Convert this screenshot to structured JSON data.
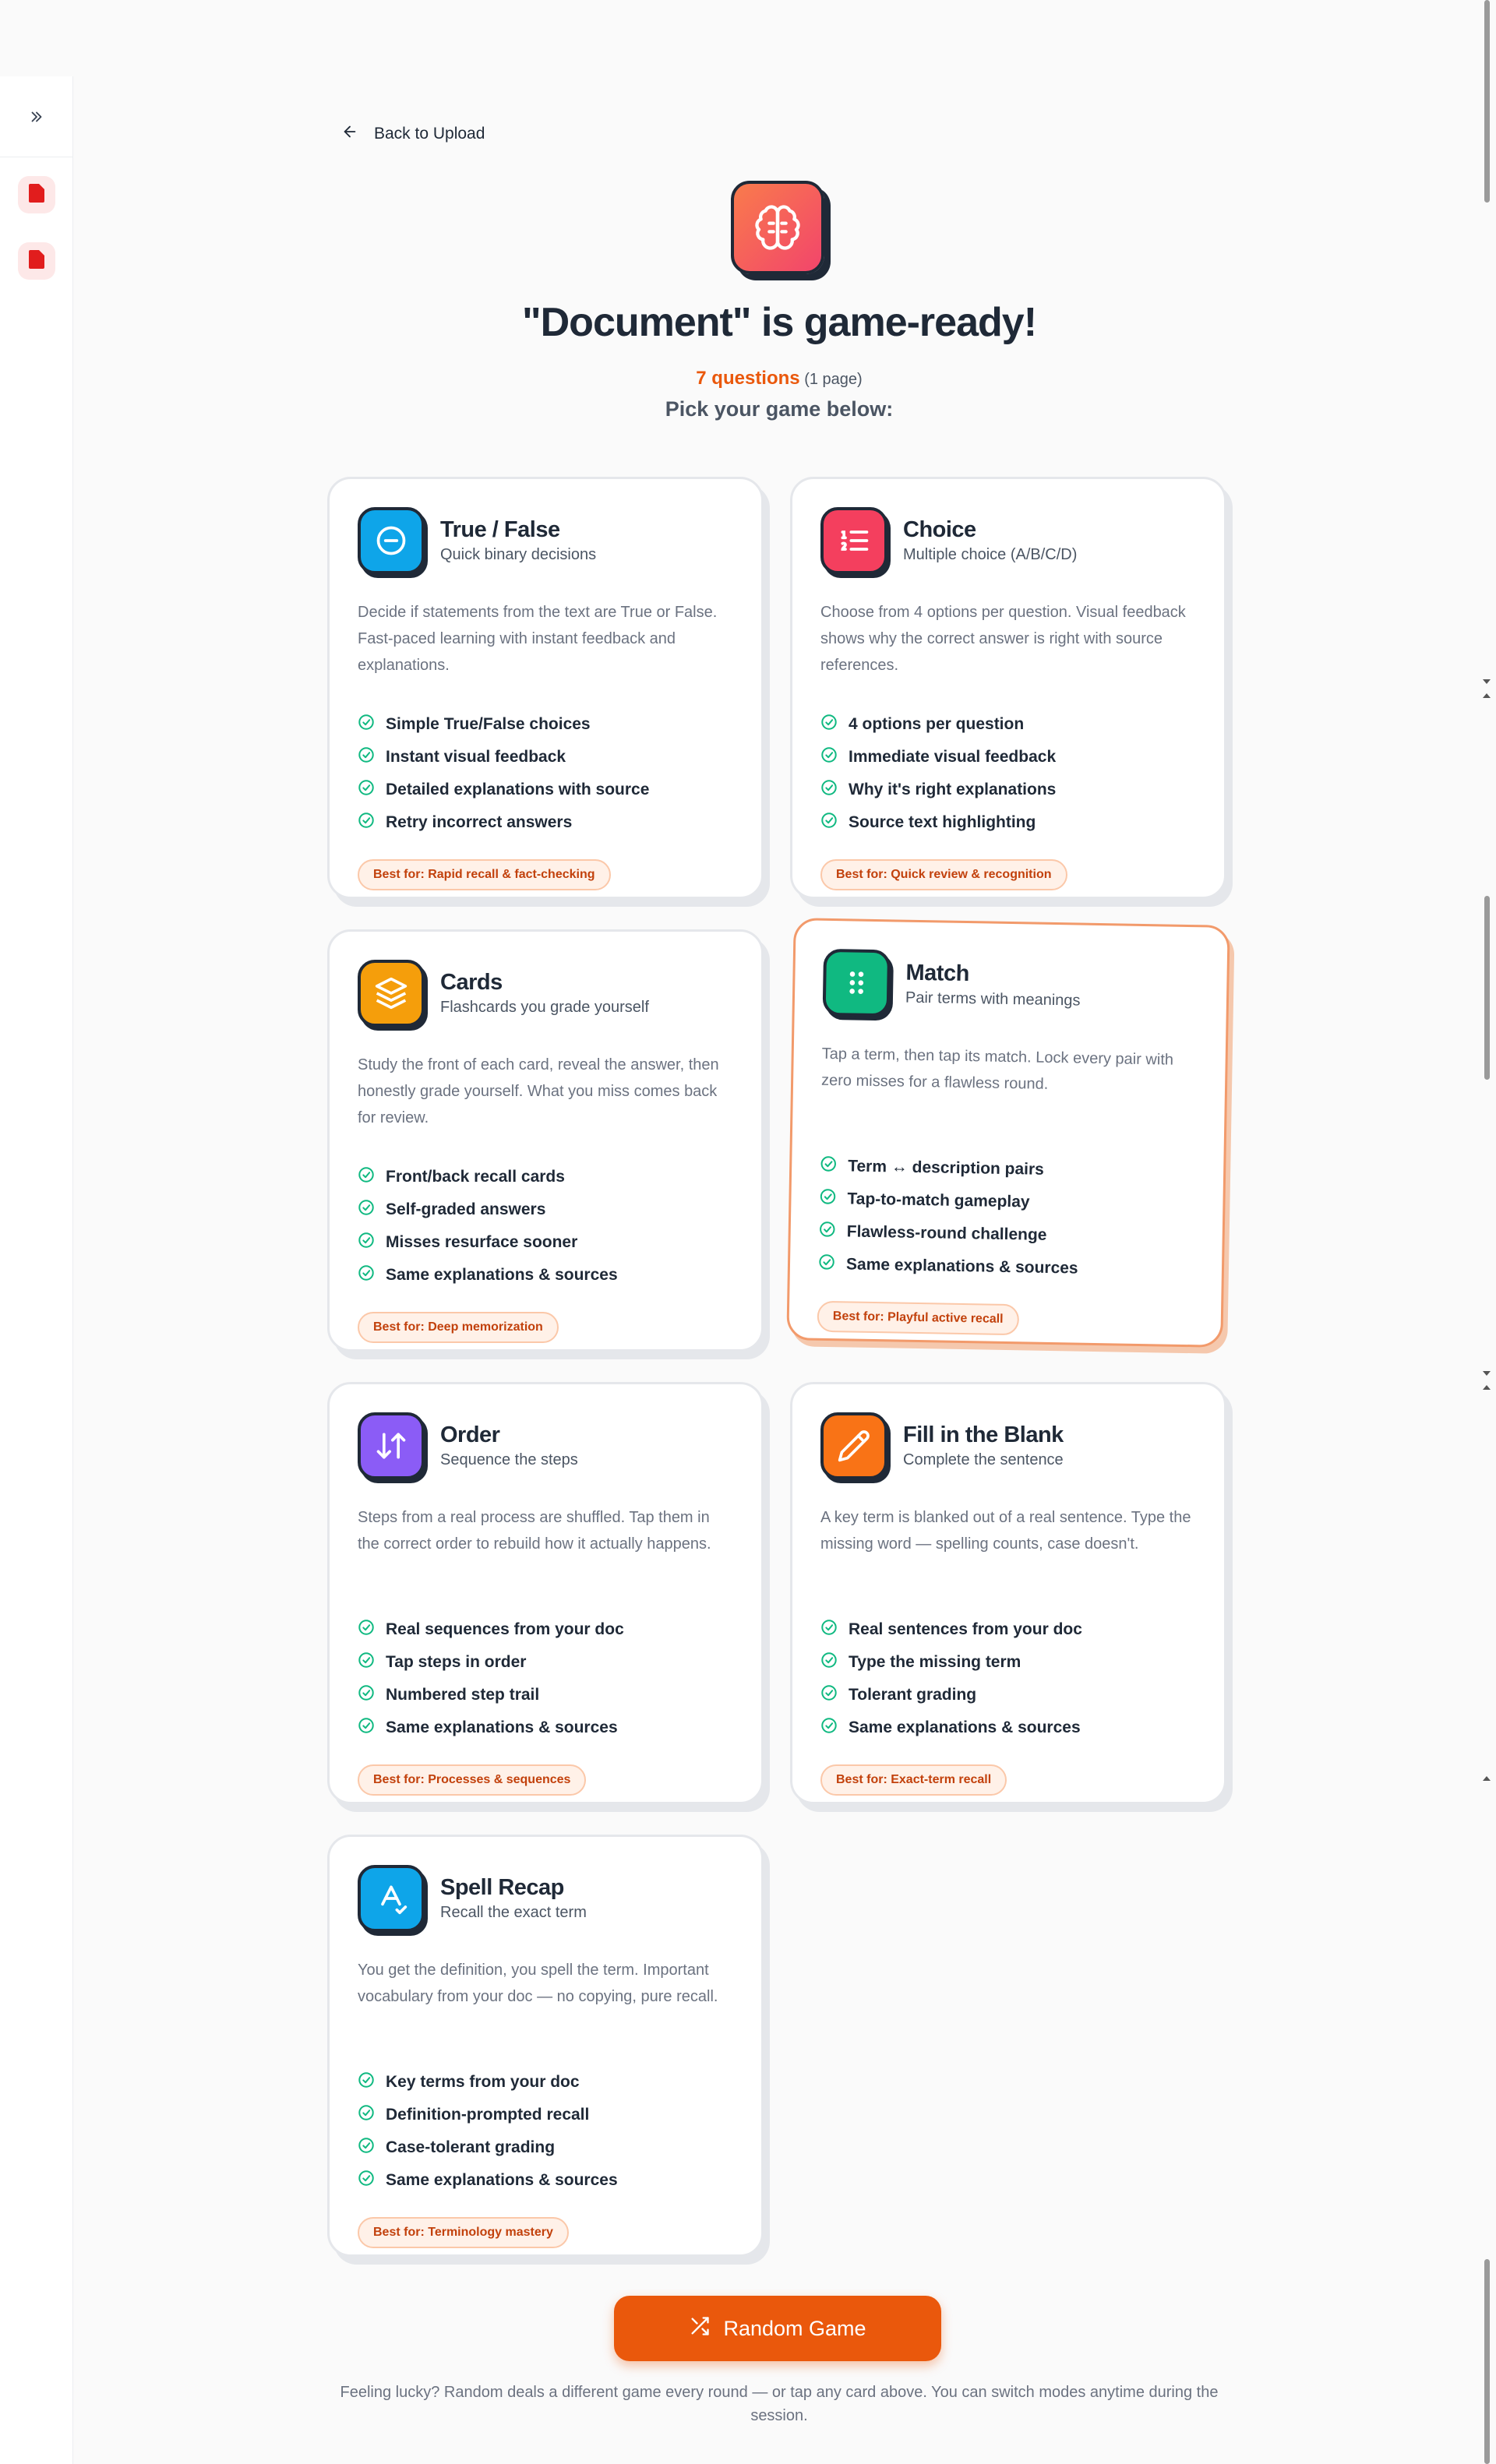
{
  "sidebar": {
    "expand_icon": "chevrons-right-icon",
    "documents": [
      {
        "icon": "pdf-file-icon",
        "color": "#e11d1d"
      },
      {
        "icon": "pdf-file-icon",
        "color": "#e11d1d"
      }
    ]
  },
  "header": {
    "back_label": "Back to Upload",
    "title": "\"Document\" is game-ready!",
    "question_count": "7 questions",
    "page_count": "(1 page)",
    "subtitle": "Pick your game below:"
  },
  "games": [
    {
      "title": "True / False",
      "subtitle": "Quick binary decisions",
      "description": "Decide if statements from the text are True or False. Fast-paced learning with instant feedback and explanations.",
      "features": [
        "Simple True/False choices",
        "Instant visual feedback",
        "Detailed explanations with source",
        "Retry incorrect answers"
      ],
      "best_for": "Best for: Rapid recall & fact-checking",
      "icon": "minus-circle-icon",
      "color": "#0ea5e9"
    },
    {
      "title": "Choice",
      "subtitle": "Multiple choice (A/B/C/D)",
      "description": "Choose from 4 options per question. Visual feedback shows why the correct answer is right with source references.",
      "features": [
        "4 options per question",
        "Immediate visual feedback",
        "Why it's right explanations",
        "Source text highlighting"
      ],
      "best_for": "Best for: Quick review & recognition",
      "icon": "list-ordered-icon",
      "color": "#f43f5e"
    },
    {
      "title": "Cards",
      "subtitle": "Flashcards you grade yourself",
      "description": "Study the front of each card, reveal the answer, then honestly grade yourself. What you miss comes back for review.",
      "features": [
        "Front/back recall cards",
        "Self-graded answers",
        "Misses resurface sooner",
        "Same explanations & sources"
      ],
      "best_for": "Best for: Deep memorization",
      "icon": "layers-icon",
      "color": "#f59e0b"
    },
    {
      "title": "Match",
      "subtitle": "Pair terms with meanings",
      "description": "Tap a term, then tap its match. Lock every pair with zero misses for a flawless round.",
      "features": [
        "Term ↔ description pairs",
        "Tap-to-match gameplay",
        "Flawless-round challenge",
        "Same explanations & sources"
      ],
      "best_for": "Best for: Playful active recall",
      "icon": "grip-icon",
      "color": "#10b981"
    },
    {
      "title": "Order",
      "subtitle": "Sequence the steps",
      "description": "Steps from a real process are shuffled. Tap them in the correct order to rebuild how it actually happens.",
      "features": [
        "Real sequences from your doc",
        "Tap steps in order",
        "Numbered step trail",
        "Same explanations & sources"
      ],
      "best_for": "Best for: Processes & sequences",
      "icon": "arrow-up-down-icon",
      "color": "#8b5cf6"
    },
    {
      "title": "Fill in the Blank",
      "subtitle": "Complete the sentence",
      "description": "A key term is blanked out of a real sentence. Type the missing word — spelling counts, case doesn't.",
      "features": [
        "Real sentences from your doc",
        "Type the missing term",
        "Tolerant grading",
        "Same explanations & sources"
      ],
      "best_for": "Best for: Exact-term recall",
      "icon": "pencil-icon",
      "color": "#f97316"
    },
    {
      "title": "Spell Recap",
      "subtitle": "Recall the exact term",
      "description": "You get the definition, you spell the term. Important vocabulary from your doc — no copying, pure recall.",
      "features": [
        "Key terms from your doc",
        "Definition-prompted recall",
        "Case-tolerant grading",
        "Same explanations & sources"
      ],
      "best_for": "Best for: Terminology mastery",
      "icon": "spell-check-icon",
      "color": "#0ea5e9"
    }
  ],
  "random_button": {
    "label": "Random Game",
    "icon": "shuffle-icon",
    "color": "#ea580c"
  },
  "footer_note": "Feeling lucky? Random deals a different game every round — or tap any card above. You can switch modes anytime during the session."
}
